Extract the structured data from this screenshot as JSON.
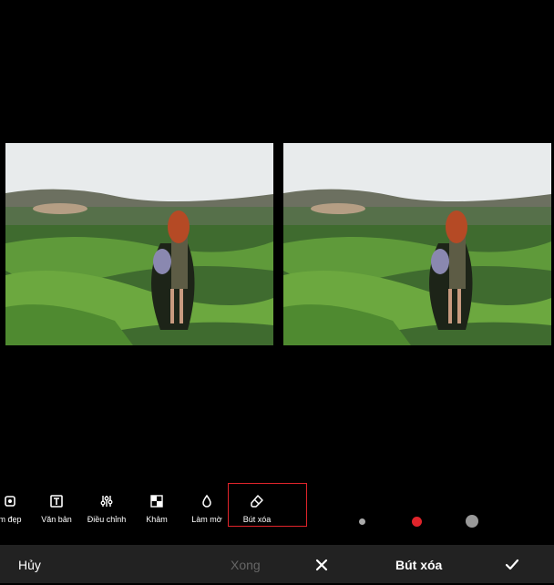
{
  "tools": [
    {
      "label": "m đẹp",
      "icon": "beauty-icon"
    },
    {
      "label": "Văn bản",
      "icon": "text-icon"
    },
    {
      "label": "Điều chỉnh",
      "icon": "adjust-sliders-icon"
    },
    {
      "label": "Khảm",
      "icon": "mosaic-icon"
    },
    {
      "label": "Làm mờ",
      "icon": "blur-drop-icon"
    },
    {
      "label": "Bút xóa",
      "icon": "eraser-icon",
      "selected": true
    }
  ],
  "brush_sizes": [
    "small",
    "medium",
    "large"
  ],
  "selected_brush": "medium",
  "footer_left": {
    "cancel": "Hủy",
    "done": "Xong"
  },
  "footer_right": {
    "title": "Bút xóa",
    "close_icon": "close-icon",
    "confirm_icon": "check-icon"
  },
  "colors": {
    "accent": "#e0242b",
    "footer_bg": "#222222",
    "disabled_text": "#666666"
  }
}
